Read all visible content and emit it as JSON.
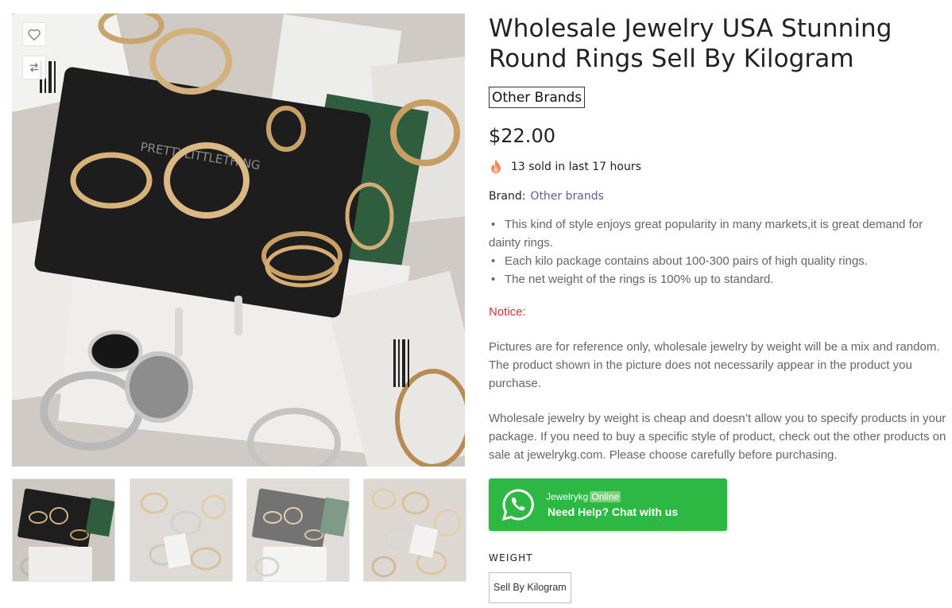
{
  "product": {
    "title_line1": "Wholesale Jewelry USA Stunning",
    "title_line2": "Round Rings Sell By Kilogram",
    "brand_tag": "Other Brands",
    "price": "$22.00",
    "sold_text": "13 sold in last 17 hours",
    "brand_label": "Brand:",
    "brand_link": "Other brands"
  },
  "description": {
    "bullets": [
      "This kind of style enjoys great popularity in many markets,it is great demand for dainty rings.",
      "Each kilo package contains about 100-300 pairs of high quality rings.",
      "The net weight of the rings is 100% up to standard."
    ],
    "bullet_symbol": "•",
    "notice": "Notice:",
    "paragraph1": "Pictures are for reference only, wholesale jewelry by weight will be a mix and random. The product shown in the picture does not necessarily appear in the product you purchase.",
    "paragraph2": "Wholesale jewelry by weight is cheap and doesn’t allow you to specify products in your package. If you need to buy a specific style of product, check out the other products on sale at jewelrykg.com. Please choose carefully before purchasing."
  },
  "chat": {
    "name": "Jewelrykg",
    "status": "Online",
    "cta": "Need Help? Chat with us"
  },
  "options": {
    "weight_label": "WEIGHT",
    "weight_value": "Sell By Kilogram"
  },
  "icons": {
    "wishlist": "heart-icon",
    "compare": "compare-arrows-icon",
    "fire": "fire-icon",
    "whatsapp": "whatsapp-icon"
  },
  "colors": {
    "chat_green": "#2db843",
    "notice_red": "#c63a3a",
    "brand_link": "#5c6491"
  }
}
